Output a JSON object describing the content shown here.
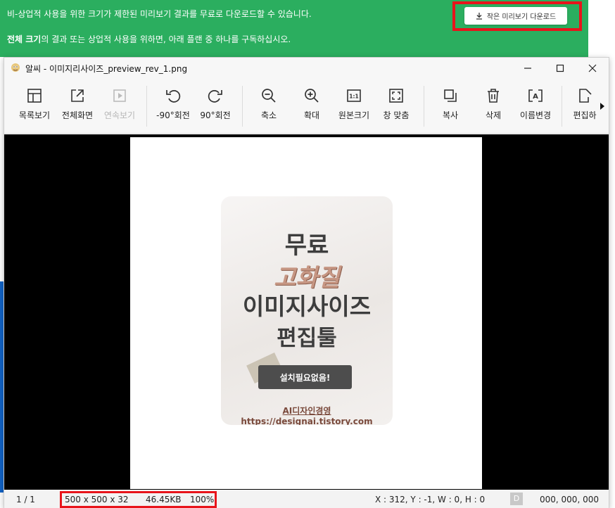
{
  "banner": {
    "line1": "비-상업적 사용을 위한 크기가 제한된 미리보기 결과를 무료로 다운로드할 수 있습니다.",
    "line2_bold": "전체 크기",
    "line2_rest": "의 결과 또는 상업적 사용을 위하면, 아래 플랜 중 하나를 구독하십시오.",
    "download_button": "작은 미리보기 다운로드"
  },
  "window": {
    "title": "알씨 - 이미지리사이즈_preview_rev_1.png",
    "controls": [
      "minimize-icon",
      "maximize-icon",
      "close-icon"
    ]
  },
  "toolbar": {
    "items": [
      {
        "label": "목록보기",
        "icon": "list-view-icon"
      },
      {
        "label": "전체화면",
        "icon": "fullscreen-icon"
      },
      {
        "label": "연속보기",
        "icon": "slideshow-icon"
      },
      {
        "label": "-90°회전",
        "icon": "rotate-left-icon"
      },
      {
        "label": "90°회전",
        "icon": "rotate-right-icon"
      },
      {
        "label": "축소",
        "icon": "zoom-out-icon"
      },
      {
        "label": "확대",
        "icon": "zoom-in-icon"
      },
      {
        "label": "원본크기",
        "icon": "original-size-icon"
      },
      {
        "label": "창 맞춤",
        "icon": "fit-window-icon"
      },
      {
        "label": "복사",
        "icon": "copy-icon"
      },
      {
        "label": "삭제",
        "icon": "delete-icon"
      },
      {
        "label": "이름변경",
        "icon": "rename-icon"
      },
      {
        "label": "편집하",
        "icon": "edit-icon"
      }
    ]
  },
  "image": {
    "line1": "무료",
    "line2": "고화질",
    "line3": "이미지사이즈",
    "line4": "편집툴",
    "button": "설치필요없음!",
    "footer": "AI디자인경영 https://designai.tistory.com"
  },
  "status": {
    "page": "1 / 1",
    "dimensions": "500 x 500 x 32",
    "filesize": "46.45KB",
    "zoom": "100%",
    "coords": "X : 312, Y : -1, W : 0, H : 0",
    "d_badge": "D",
    "rgb": "000, 000, 000"
  },
  "colors": {
    "banner": "#2bae5f",
    "highlight": "#e8141b"
  }
}
